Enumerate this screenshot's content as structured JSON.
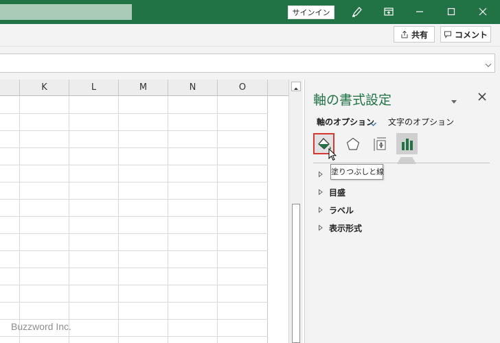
{
  "titlebar": {
    "signin_label": "サインイン",
    "bg_color": "#217346"
  },
  "ribbon": {
    "share_label": "共有",
    "comment_label": "コメント"
  },
  "grid": {
    "columns": [
      "K",
      "L",
      "M",
      "N",
      "O"
    ]
  },
  "pane": {
    "title": "軸の書式設定",
    "tabs": [
      {
        "label": "軸のオプション",
        "active": true
      },
      {
        "label": "文字のオプション",
        "active": false
      }
    ],
    "icons": [
      "paint-bucket-icon",
      "pentagon-icon",
      "size-properties-icon",
      "bar-chart-icon"
    ],
    "tooltip": "塗りつぶしと線",
    "sections": [
      "目盛",
      "ラベル",
      "表示形式"
    ]
  },
  "watermark": "Buzzword Inc."
}
